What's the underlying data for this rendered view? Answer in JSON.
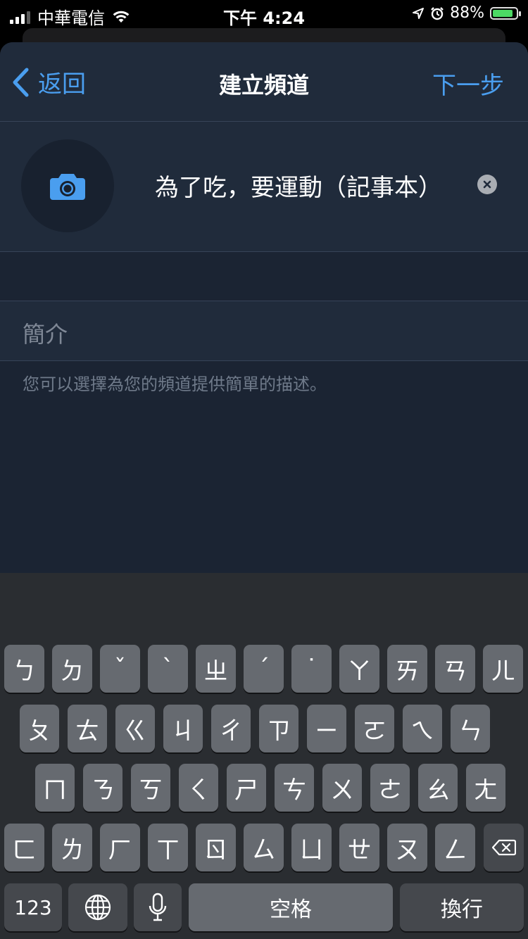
{
  "status_bar": {
    "carrier": "中華電信",
    "time": "下午 4:24",
    "battery_percent": "88%",
    "battery_level": 0.88
  },
  "nav": {
    "back_label": "返回",
    "title": "建立頻道",
    "next_label": "下一步"
  },
  "channel": {
    "name": "為了吃，要運動（記事本）"
  },
  "description": {
    "placeholder": "簡介",
    "hint": "您可以選擇為您的頻道提供簡單的描述。"
  },
  "keyboard": {
    "row1": [
      "ㄅ",
      "ㄉ",
      "ˇ",
      "ˋ",
      "ㄓ",
      "ˊ",
      "˙",
      "ㄚ",
      "ㄞ",
      "ㄢ",
      "ㄦ"
    ],
    "row2": [
      "ㄆ",
      "ㄊ",
      "ㄍ",
      "ㄐ",
      "ㄔ",
      "ㄗ",
      "ㄧ",
      "ㄛ",
      "ㄟ",
      "ㄣ"
    ],
    "row3": [
      "ㄇ",
      "ㄋ",
      "ㄎ",
      "ㄑ",
      "ㄕ",
      "ㄘ",
      "ㄨ",
      "ㄜ",
      "ㄠ",
      "ㄤ"
    ],
    "row4": [
      "ㄈ",
      "ㄌ",
      "ㄏ",
      "ㄒ",
      "ㄖ",
      "ㄙ",
      "ㄩ",
      "ㄝ",
      "ㄡ",
      "ㄥ"
    ],
    "numbers_label": "123",
    "space_label": "空格",
    "return_label": "換行",
    "icons": {
      "globe": "globe-icon",
      "mic": "microphone-icon",
      "delete": "backspace-icon"
    }
  }
}
